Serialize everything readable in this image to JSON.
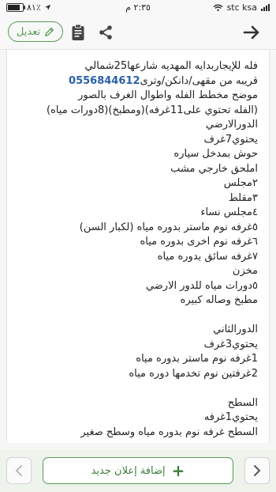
{
  "status_bar": {
    "battery": "٨١٪",
    "time": "٢:٣٥ م",
    "carrier": "stc ksa",
    "battery_level": 0.81
  },
  "toolbar": {
    "edit_label": "تعديل",
    "icons": {
      "edit": "pencil-icon",
      "clipboard": "clipboard-icon",
      "share": "share-icon",
      "forward": "arrow-right-icon"
    }
  },
  "ad": {
    "line1": "فله للإيجاربدايه المهديه شارعها25شمالي",
    "line2_prefix": "قريبه من مقهى/دانكن/وترى",
    "phone": "0556844612",
    "line3": "موضح مخطط الفله واطوال الغرف بالصور",
    "lines": [
      "(الفله تحتوي على11غرفه)(ومطبخ)(8دورات مياه)",
      "الدورالارضي",
      "يحتوي7غرف",
      "حوش بمدخل سياره",
      "املحق خارجي مشب",
      "٢مجلس",
      "٣مقلط",
      "٤مجلس نساء",
      "٥غرفه نوم ماستر بدوره مياه (لكبار السن)",
      "٦غرفه نوم اخرى بدوره مياه",
      "٧غرفه سائق بدوره مياه",
      "مخزن",
      "٥دورات مياه للدور الارضي",
      "مطبخ وصاله كبيره",
      "",
      "الدورالثاني",
      "يحتوي3غرف",
      "1غرفه نوم ماستر بدوره مياه",
      "2غرفتين نوم تخدمها  دوره مياه",
      "",
      "السطح",
      "يحتوي1غرفه",
      "السطح غرفه نوم بدوره مياه وسطح صغير"
    ]
  },
  "bottom_bar": {
    "add_label": "إضافة إعلان جديد",
    "add_icon": "plus-icon",
    "prev_icon": "chevron-left-icon",
    "next_icon": "chevron-right-icon"
  },
  "colors": {
    "accent": "#5a9c55",
    "phone": "#2a5fa8",
    "bottom_bg": "#eef3ec"
  }
}
